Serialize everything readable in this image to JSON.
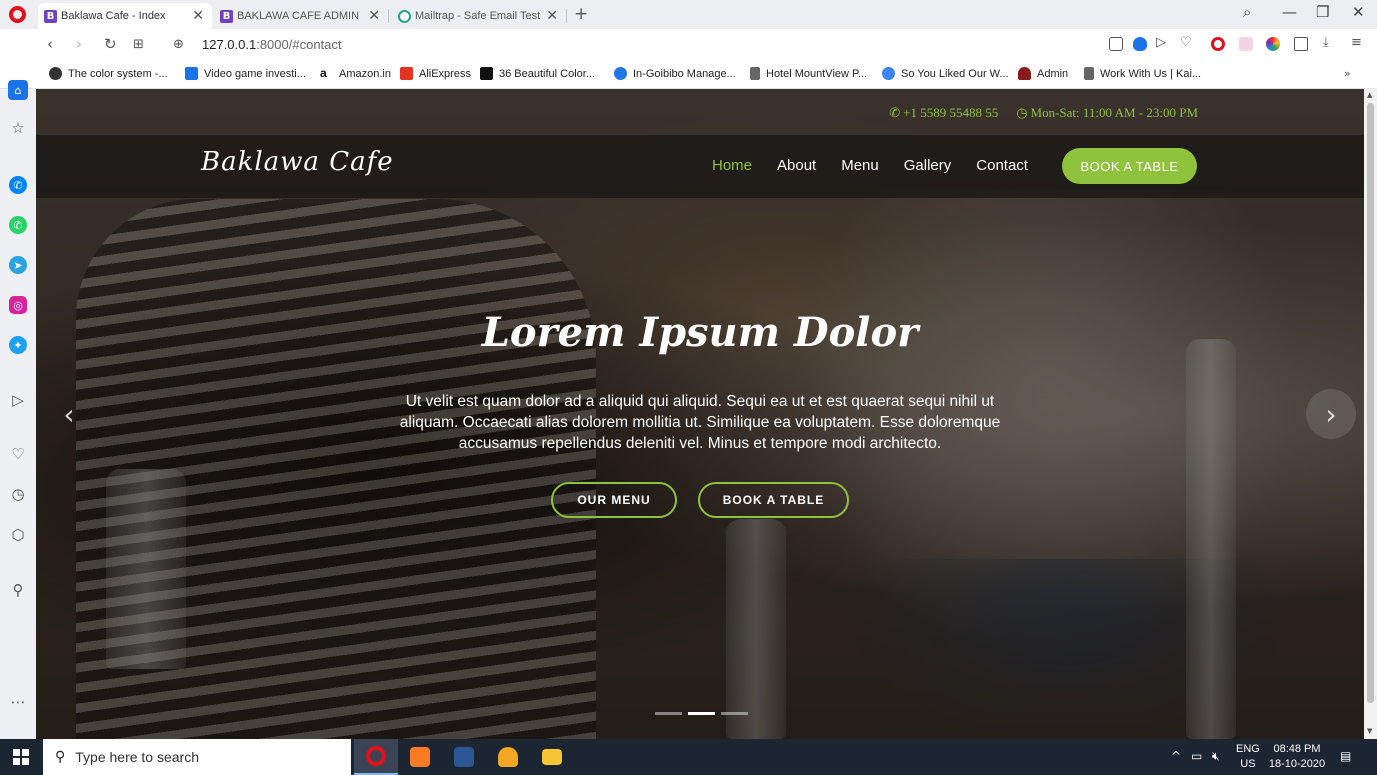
{
  "browser": {
    "tabs": [
      {
        "icon": "B",
        "title": "Baklawa Cafe - Index",
        "active": true
      },
      {
        "icon": "B",
        "title": "BAKLAWA CAFE ADMIN PA",
        "active": false
      },
      {
        "icon": "mailtrap-icon",
        "title": "Mailtrap - Safe Email Testin",
        "active": false
      }
    ],
    "url": {
      "host": "127.0.0.1",
      "rest": ":8000/#contact"
    },
    "bookmarks": [
      {
        "label": "The color system -...",
        "color": "#333333"
      },
      {
        "label": "Video game investi...",
        "color": "#1a73e8"
      },
      {
        "label": "Amazon.in",
        "color": "#111111"
      },
      {
        "label": "AliExpress",
        "color": "#e43225"
      },
      {
        "label": "36 Beautiful Color...",
        "color": "#111111"
      },
      {
        "label": "In-Goibibo Manage...",
        "color": "#2276e3"
      },
      {
        "label": "Hotel MountView P...",
        "color": "#555555"
      },
      {
        "label": "So You Liked Our W...",
        "color": "#3b82f6"
      },
      {
        "label": "Admin",
        "color": "#8b1a1a"
      },
      {
        "label": "Work With Us | Kai...",
        "color": "#555555"
      }
    ]
  },
  "site": {
    "phone": "+1 5589 55488 55",
    "hours": "Mon-Sat: 11:00 AM - 23:00 PM",
    "logo": "Baklawa Cafe",
    "nav": [
      {
        "label": "Home",
        "current": true
      },
      {
        "label": "About",
        "current": false
      },
      {
        "label": "Menu",
        "current": false
      },
      {
        "label": "Gallery",
        "current": false
      },
      {
        "label": "Contact",
        "current": false
      }
    ],
    "book_button": "BOOK A TABLE",
    "hero": {
      "title": "Lorem Ipsum Dolor",
      "text": "Ut velit est quam dolor ad a aliquid qui aliquid. Sequi ea ut et est quaerat sequi nihil ut aliquam. Occaecati alias dolorem mollitia ut. Similique ea voluptatem. Esse doloremque accusamus repellendus deleniti vel. Minus et tempore modi architecto.",
      "btn_menu": "OUR MENU",
      "btn_book": "BOOK A TABLE",
      "slide_count": 3,
      "active_slide": 2
    },
    "accent": "#8fc23d"
  },
  "taskbar": {
    "search_placeholder": "Type here to search",
    "lang_top": "ENG",
    "lang_bottom": "US",
    "time": "08:48 PM",
    "date": "18-10-2020"
  }
}
